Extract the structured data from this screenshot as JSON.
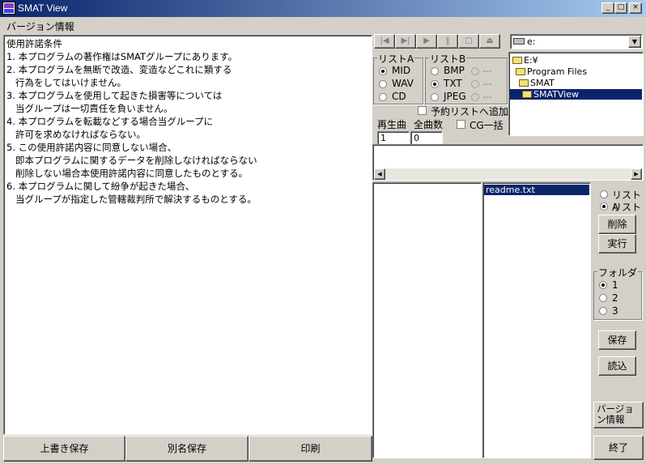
{
  "window": {
    "title": "SMAT  View",
    "minimize": "_",
    "maximize": "□",
    "close": "×"
  },
  "menu": {
    "version_info": "バージョン情報"
  },
  "license_text": [
    "使用許諾条件",
    "1. 本プログラムの著作権はSMATグループにあります。",
    "2. 本プログラムを無断で改造、変造などこれに類する",
    "   行為をしてはいけません。",
    "3. 本プログラムを使用して起きた損害等については",
    "   当グループは一切責任を負いません。",
    "4. 本プログラムを転載などする場合当グループに",
    "   許可を求めなければならない。",
    "5. この使用許諾内容に同意しない場合、",
    "   即本プログラムに関するデータを削除しなければならない",
    "   削除しない場合本使用許諾内容に同意したものとする。",
    "6. 本プログラムに関して紛争が起きた場合、",
    "   当グループが指定した管轄裁判所で解決するものとする。"
  ],
  "bottom_buttons": {
    "overwrite_save": "上書き保存",
    "save_as": "別名保存",
    "print": "印刷"
  },
  "drive": {
    "value": "e:",
    "icon": "drive-icon"
  },
  "tree": [
    "E:¥",
    "Program Files",
    "SMAT",
    "SMATView"
  ],
  "list_a": {
    "label": "リストA",
    "options": [
      "MID",
      "WAV",
      "CD"
    ],
    "selected": "MID"
  },
  "list_b": {
    "label": "リストB",
    "options": [
      "BMP",
      "TXT",
      "JPEG"
    ],
    "selected": "TXT",
    "dash": "---"
  },
  "reserve_add": "予約リストへ追加",
  "play_label": "再生曲",
  "total_label": "全曲数",
  "play_value": "1",
  "total_value": "0",
  "cg_all": "CG一括",
  "file_list": [
    "readme.txt"
  ],
  "list_select": {
    "options": [
      "リストA",
      "リストB"
    ],
    "selected": "リストB"
  },
  "actions": {
    "delete": "削除",
    "execute": "実行"
  },
  "folder": {
    "label": "フォルダ",
    "options": [
      "1",
      "2",
      "3"
    ],
    "selected": "1"
  },
  "side_buttons": {
    "save": "保存",
    "load": "読込",
    "version": "バージョン情報",
    "exit": "終了"
  },
  "colors": {
    "title_start": "#0a246a",
    "title_end": "#a6caf0",
    "selection": "#0a246a",
    "face": "#d4d0c8"
  }
}
